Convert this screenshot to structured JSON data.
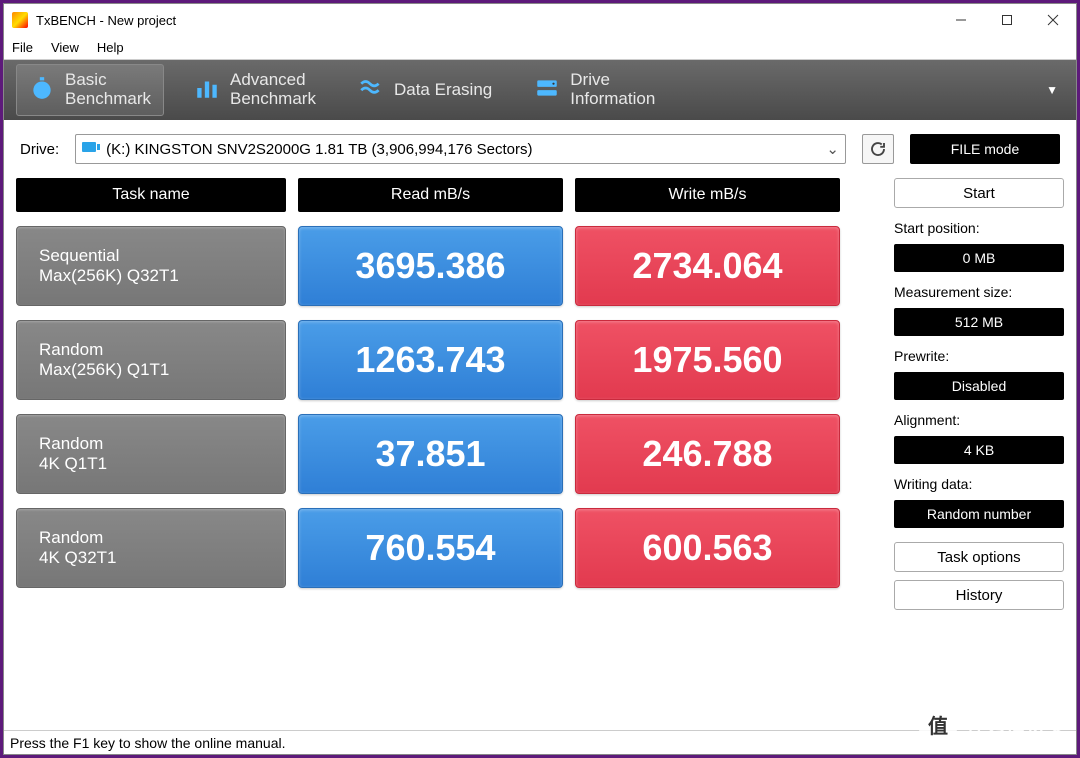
{
  "window": {
    "title": "TxBENCH - New project"
  },
  "menu": {
    "file": "File",
    "view": "View",
    "help": "Help"
  },
  "tabs": {
    "basic1": "Basic",
    "basic2": "Benchmark",
    "adv1": "Advanced",
    "adv2": "Benchmark",
    "erase": "Data Erasing",
    "drive1": "Drive",
    "drive2": "Information"
  },
  "drive": {
    "label": "Drive:",
    "selected": "(K:) KINGSTON SNV2S2000G  1.81 TB (3,906,994,176 Sectors)"
  },
  "filemode": "FILE mode",
  "headers": {
    "task": "Task name",
    "read": "Read mB/s",
    "write": "Write mB/s"
  },
  "rows": [
    {
      "name1": "Sequential",
      "name2": "Max(256K) Q32T1",
      "read": "3695.386",
      "write": "2734.064"
    },
    {
      "name1": "Random",
      "name2": "Max(256K) Q1T1",
      "read": "1263.743",
      "write": "1975.560"
    },
    {
      "name1": "Random",
      "name2": "4K Q1T1",
      "read": "37.851",
      "write": "246.788"
    },
    {
      "name1": "Random",
      "name2": "4K Q32T1",
      "read": "760.554",
      "write": "600.563"
    }
  ],
  "side": {
    "start": "Start",
    "startpos_label": "Start position:",
    "startpos": "0 MB",
    "measize_label": "Measurement size:",
    "measize": "512 MB",
    "prewrite_label": "Prewrite:",
    "prewrite": "Disabled",
    "align_label": "Alignment:",
    "align": "4 KB",
    "wdata_label": "Writing data:",
    "wdata": "Random number",
    "taskopt": "Task options",
    "history": "History"
  },
  "status": "Press the F1 key to show the online manual.",
  "watermark": {
    "char": "值",
    "text": "什么值得买"
  }
}
